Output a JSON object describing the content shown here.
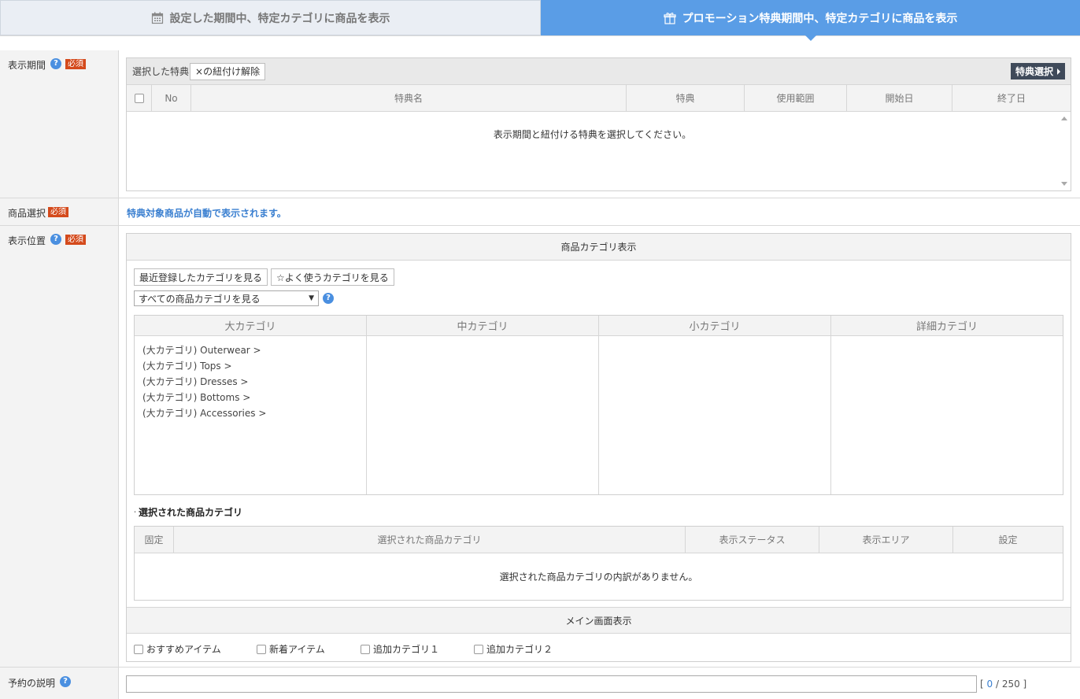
{
  "tabs": [
    {
      "label": "設定した期間中、特定カテゴリに商品を表示",
      "icon": "calendar-icon",
      "active": false
    },
    {
      "label": "プロモーション特典期間中、特定カテゴリに商品を表示",
      "icon": "gift-icon",
      "active": true
    }
  ],
  "colors": {
    "accent": "#5a9de6",
    "required": "#d44a1c",
    "help": "#4a8fe0",
    "dark_button": "#3f4a5a",
    "link_blue": "#3a7fd0"
  },
  "rows": {
    "period": {
      "label": "表示期間",
      "required": "必須",
      "toolbar_label": "選択した特典",
      "unlink_button": "×の紐付け解除",
      "select_button": "特典選択",
      "columns": [
        "No",
        "特典名",
        "特典",
        "使用範囲",
        "開始日",
        "終了日"
      ],
      "empty_message": "表示期間と紐付ける特典を選択してください。"
    },
    "product": {
      "label": "商品選択",
      "required": "必須",
      "message": "特典対象商品が自動で表示されます。"
    },
    "position": {
      "label": "表示位置",
      "required": "必須",
      "category_section_title": "商品カテゴリ表示",
      "recent_button": "最近登録したカテゴリを見る",
      "frequent_button": "☆よく使うカテゴリを見る",
      "category_select": "すべての商品カテゴリを見る",
      "category_columns": [
        "大カテゴリ",
        "中カテゴリ",
        "小カテゴリ",
        "詳細カテゴリ"
      ],
      "major_categories": [
        "(大カテゴリ) Outerwear >",
        "(大カテゴリ) Tops >",
        "(大カテゴリ) Dresses >",
        "(大カテゴリ) Bottoms >",
        "(大カテゴリ) Accessories >"
      ],
      "selected_title": "選択された商品カテゴリ",
      "selected_columns": [
        "固定",
        "選択された商品カテゴリ",
        "表示ステータス",
        "表示エリア",
        "設定"
      ],
      "selected_empty": "選択された商品カテゴリの内訳がありません。",
      "main_section_title": "メイン画面表示",
      "main_options": [
        "おすすめアイテム",
        "新着アイテム",
        "追加カテゴリ１",
        "追加カテゴリ２"
      ]
    },
    "description": {
      "label": "予約の説明",
      "value": "",
      "count_current": "0",
      "count_max": "250"
    }
  }
}
